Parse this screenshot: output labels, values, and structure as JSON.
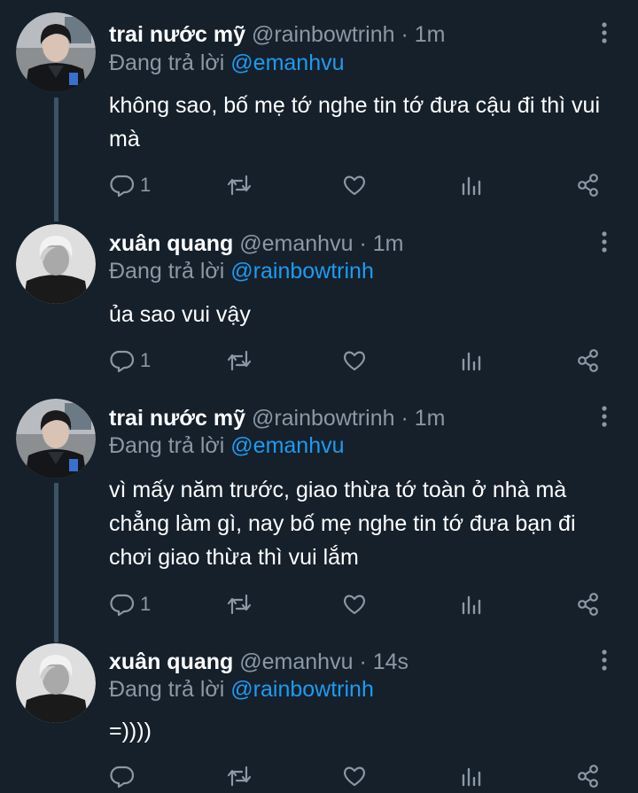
{
  "colors": {
    "background": "#15202b",
    "text_primary": "#ffffff",
    "text_secondary": "#8b98a5",
    "accent": "#1d9bf0",
    "thread_line": "#3d5466"
  },
  "icons": {
    "reply": "reply-icon",
    "retweet": "retweet-icon",
    "like": "heart-icon",
    "analytics": "analytics-icon",
    "share": "share-icon",
    "more": "more-vertical-icon"
  },
  "tweets": [
    {
      "display_name": "trai nước mỹ",
      "handle": "@rainbowtrinh",
      "separator": "·",
      "time": "1m",
      "reply_prefix": "Đang trả lời",
      "reply_to": "@emanhvu",
      "text": "không sao, bố mẹ tớ nghe tin tớ đưa cậu đi thì vui mà",
      "reply_count": "1"
    },
    {
      "display_name": "xuân quang",
      "handle": "@emanhvu",
      "separator": "·",
      "time": "1m",
      "reply_prefix": "Đang trả lời",
      "reply_to": "@rainbowtrinh",
      "text": "ủa sao vui vậy",
      "reply_count": "1"
    },
    {
      "display_name": "trai nước mỹ",
      "handle": "@rainbowtrinh",
      "separator": "·",
      "time": "1m",
      "reply_prefix": "Đang trả lời",
      "reply_to": "@emanhvu",
      "text": "vì mấy năm trước, giao thừa tớ toàn ở nhà mà chẳng làm gì, nay bố mẹ nghe tin tớ đưa bạn đi chơi giao thừa thì vui lắm",
      "reply_count": "1"
    },
    {
      "display_name": "xuân quang",
      "handle": "@emanhvu",
      "separator": "·",
      "time": "14s",
      "reply_prefix": "Đang trả lời",
      "reply_to": "@rainbowtrinh",
      "text": "=))))",
      "reply_count": ""
    }
  ]
}
